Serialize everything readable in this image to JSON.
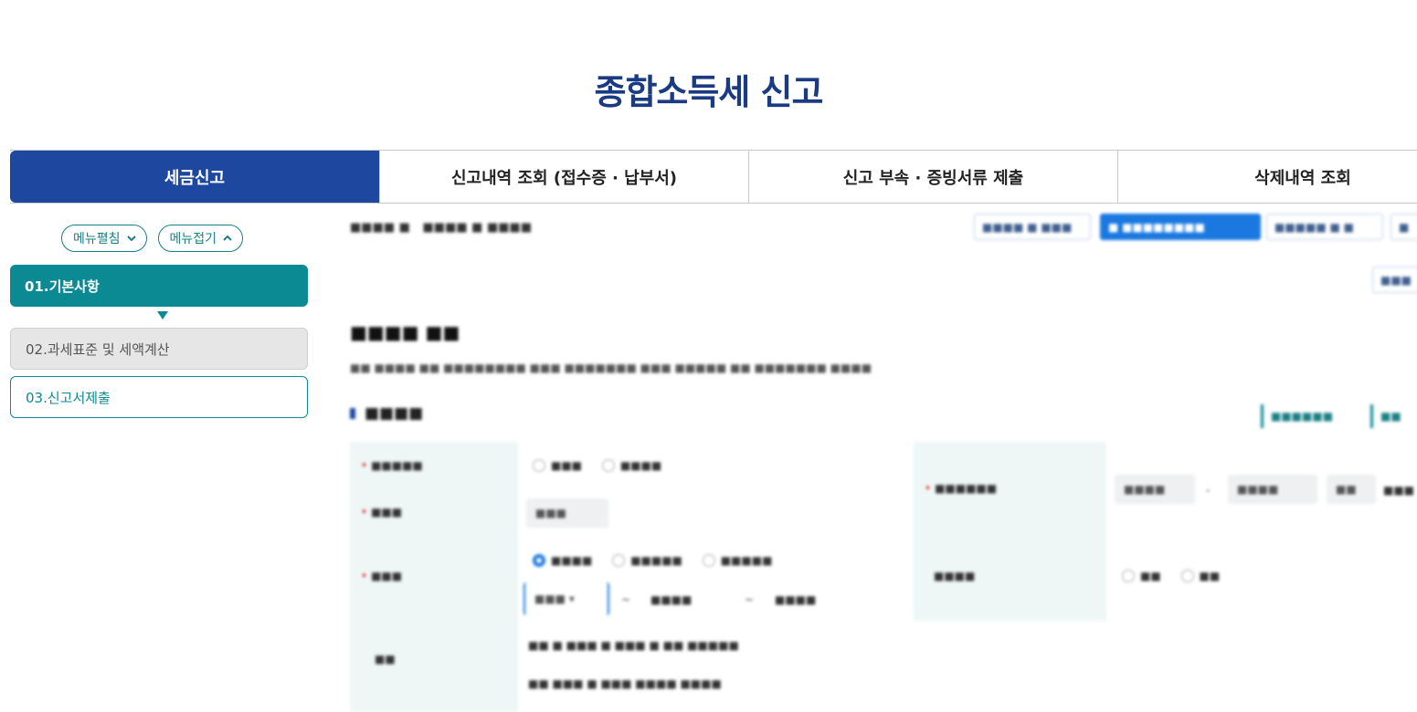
{
  "page_title": "종합소득세 신고",
  "tabs": [
    {
      "label": "세금신고"
    },
    {
      "label": "신고내역 조회 (접수증 · 납부서)"
    },
    {
      "label": "신고 부속 · 증빙서류 제출"
    },
    {
      "label": "삭제내역 조회"
    }
  ],
  "menu_toggles": {
    "expand": "메뉴펼침",
    "collapse": "메뉴접기"
  },
  "steps": [
    {
      "label": "01.기본사항"
    },
    {
      "label": "02.과세표준 및 세액계산"
    },
    {
      "label": "03.신고서제출"
    }
  ],
  "colors": {
    "brand": "#1e47a0",
    "accent": "#0b8a93",
    "primary_button": "#1a78e0"
  }
}
